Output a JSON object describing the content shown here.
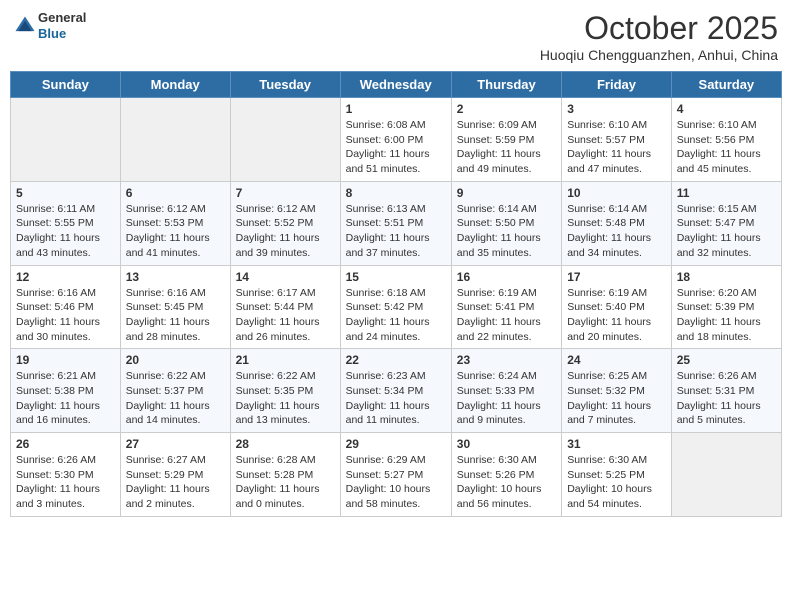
{
  "header": {
    "logo": {
      "line1": "General",
      "line2": "Blue"
    },
    "month": "October 2025",
    "location": "Huoqiu Chengguanzhen, Anhui, China"
  },
  "days_of_week": [
    "Sunday",
    "Monday",
    "Tuesday",
    "Wednesday",
    "Thursday",
    "Friday",
    "Saturday"
  ],
  "weeks": [
    [
      {
        "day": "",
        "content": ""
      },
      {
        "day": "",
        "content": ""
      },
      {
        "day": "",
        "content": ""
      },
      {
        "day": "1",
        "content": "Sunrise: 6:08 AM\nSunset: 6:00 PM\nDaylight: 11 hours and 51 minutes."
      },
      {
        "day": "2",
        "content": "Sunrise: 6:09 AM\nSunset: 5:59 PM\nDaylight: 11 hours and 49 minutes."
      },
      {
        "day": "3",
        "content": "Sunrise: 6:10 AM\nSunset: 5:57 PM\nDaylight: 11 hours and 47 minutes."
      },
      {
        "day": "4",
        "content": "Sunrise: 6:10 AM\nSunset: 5:56 PM\nDaylight: 11 hours and 45 minutes."
      }
    ],
    [
      {
        "day": "5",
        "content": "Sunrise: 6:11 AM\nSunset: 5:55 PM\nDaylight: 11 hours and 43 minutes."
      },
      {
        "day": "6",
        "content": "Sunrise: 6:12 AM\nSunset: 5:53 PM\nDaylight: 11 hours and 41 minutes."
      },
      {
        "day": "7",
        "content": "Sunrise: 6:12 AM\nSunset: 5:52 PM\nDaylight: 11 hours and 39 minutes."
      },
      {
        "day": "8",
        "content": "Sunrise: 6:13 AM\nSunset: 5:51 PM\nDaylight: 11 hours and 37 minutes."
      },
      {
        "day": "9",
        "content": "Sunrise: 6:14 AM\nSunset: 5:50 PM\nDaylight: 11 hours and 35 minutes."
      },
      {
        "day": "10",
        "content": "Sunrise: 6:14 AM\nSunset: 5:48 PM\nDaylight: 11 hours and 34 minutes."
      },
      {
        "day": "11",
        "content": "Sunrise: 6:15 AM\nSunset: 5:47 PM\nDaylight: 11 hours and 32 minutes."
      }
    ],
    [
      {
        "day": "12",
        "content": "Sunrise: 6:16 AM\nSunset: 5:46 PM\nDaylight: 11 hours and 30 minutes."
      },
      {
        "day": "13",
        "content": "Sunrise: 6:16 AM\nSunset: 5:45 PM\nDaylight: 11 hours and 28 minutes."
      },
      {
        "day": "14",
        "content": "Sunrise: 6:17 AM\nSunset: 5:44 PM\nDaylight: 11 hours and 26 minutes."
      },
      {
        "day": "15",
        "content": "Sunrise: 6:18 AM\nSunset: 5:42 PM\nDaylight: 11 hours and 24 minutes."
      },
      {
        "day": "16",
        "content": "Sunrise: 6:19 AM\nSunset: 5:41 PM\nDaylight: 11 hours and 22 minutes."
      },
      {
        "day": "17",
        "content": "Sunrise: 6:19 AM\nSunset: 5:40 PM\nDaylight: 11 hours and 20 minutes."
      },
      {
        "day": "18",
        "content": "Sunrise: 6:20 AM\nSunset: 5:39 PM\nDaylight: 11 hours and 18 minutes."
      }
    ],
    [
      {
        "day": "19",
        "content": "Sunrise: 6:21 AM\nSunset: 5:38 PM\nDaylight: 11 hours and 16 minutes."
      },
      {
        "day": "20",
        "content": "Sunrise: 6:22 AM\nSunset: 5:37 PM\nDaylight: 11 hours and 14 minutes."
      },
      {
        "day": "21",
        "content": "Sunrise: 6:22 AM\nSunset: 5:35 PM\nDaylight: 11 hours and 13 minutes."
      },
      {
        "day": "22",
        "content": "Sunrise: 6:23 AM\nSunset: 5:34 PM\nDaylight: 11 hours and 11 minutes."
      },
      {
        "day": "23",
        "content": "Sunrise: 6:24 AM\nSunset: 5:33 PM\nDaylight: 11 hours and 9 minutes."
      },
      {
        "day": "24",
        "content": "Sunrise: 6:25 AM\nSunset: 5:32 PM\nDaylight: 11 hours and 7 minutes."
      },
      {
        "day": "25",
        "content": "Sunrise: 6:26 AM\nSunset: 5:31 PM\nDaylight: 11 hours and 5 minutes."
      }
    ],
    [
      {
        "day": "26",
        "content": "Sunrise: 6:26 AM\nSunset: 5:30 PM\nDaylight: 11 hours and 3 minutes."
      },
      {
        "day": "27",
        "content": "Sunrise: 6:27 AM\nSunset: 5:29 PM\nDaylight: 11 hours and 2 minutes."
      },
      {
        "day": "28",
        "content": "Sunrise: 6:28 AM\nSunset: 5:28 PM\nDaylight: 11 hours and 0 minutes."
      },
      {
        "day": "29",
        "content": "Sunrise: 6:29 AM\nSunset: 5:27 PM\nDaylight: 10 hours and 58 minutes."
      },
      {
        "day": "30",
        "content": "Sunrise: 6:30 AM\nSunset: 5:26 PM\nDaylight: 10 hours and 56 minutes."
      },
      {
        "day": "31",
        "content": "Sunrise: 6:30 AM\nSunset: 5:25 PM\nDaylight: 10 hours and 54 minutes."
      },
      {
        "day": "",
        "content": ""
      }
    ]
  ]
}
